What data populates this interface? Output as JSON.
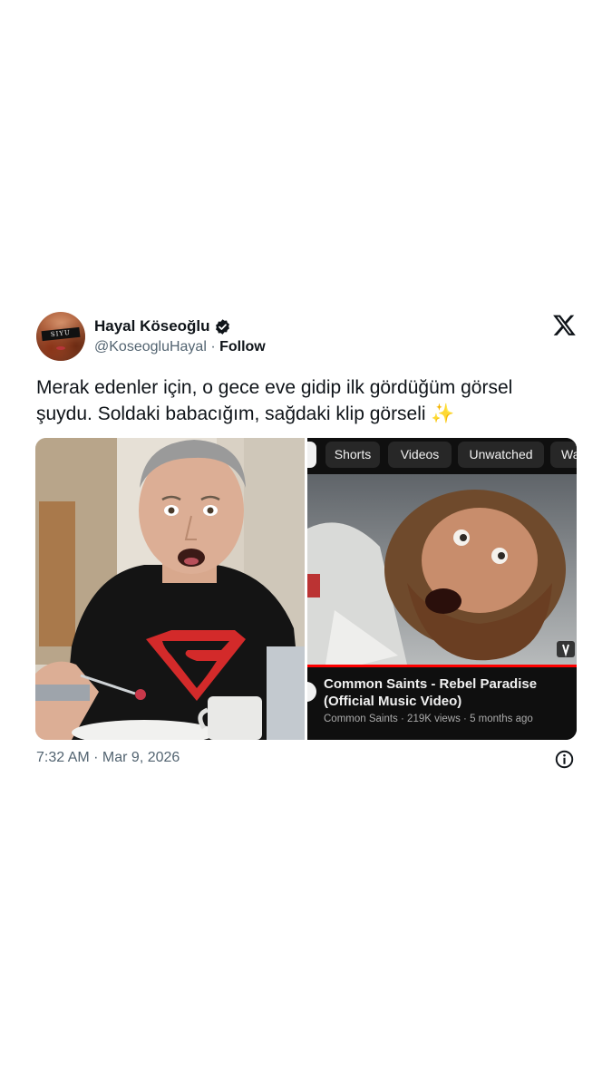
{
  "author": {
    "name": "Hayal Köseoğlu",
    "handle": "@KoseogluHayal",
    "separator": " · ",
    "follow_label": "Follow",
    "avatar_band_text": "SIYU"
  },
  "tweet": {
    "line1": "Merak edenler için, o gece eve gidip ilk gördüğüm görsel",
    "line2": "şuydu. Soldaki babacığım, sağdaki klip görseli ✨",
    "timestamp": "7:32 AM · Mar 9, 2026"
  },
  "media": {
    "youtube": {
      "chips": [
        "Shorts",
        "Videos",
        "Unwatched",
        "Wa"
      ],
      "video_title_line1": "Common Saints - Rebel Paradise",
      "video_title_line2": "(Official Music Video)",
      "channel": "Common Saints",
      "views": "219K views",
      "age": "5 months ago",
      "meta_sep": " · ",
      "progress_color": "#ff0000"
    },
    "left_photo": {
      "shirt_logo": "S"
    }
  },
  "icons": {
    "verified": "verified-badge-icon",
    "platform": "x-logo-icon",
    "info": "info-icon",
    "shorts": "shorts-icon"
  },
  "colors": {
    "text_primary": "#0f1419",
    "text_secondary": "#536471",
    "yt_background": "#0f0f0f",
    "yt_chip": "#272727"
  }
}
